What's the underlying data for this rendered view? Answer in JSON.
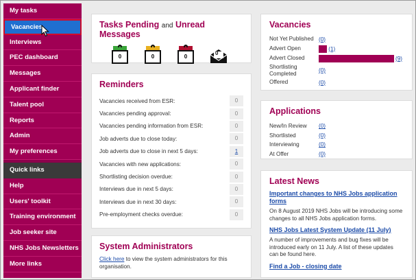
{
  "sidebar": {
    "items": [
      {
        "label": "My tasks"
      },
      {
        "label": "Vacancies"
      },
      {
        "label": "Interviews"
      },
      {
        "label": "PEC dashboard"
      },
      {
        "label": "Messages"
      },
      {
        "label": "Applicant finder"
      },
      {
        "label": "Talent pool"
      },
      {
        "label": "Reports"
      },
      {
        "label": "Admin"
      },
      {
        "label": "My preferences"
      }
    ],
    "quick_links_header": "Quick links",
    "quick_links": [
      {
        "label": "Help"
      },
      {
        "label": "Users' toolkit"
      },
      {
        "label": "Training environment"
      },
      {
        "label": "Job seeker site"
      },
      {
        "label": "NHS Jobs Newsletters"
      },
      {
        "label": "More links"
      }
    ],
    "active_color": "#1f6fd0",
    "brand_color": "#a00054"
  },
  "tasks": {
    "title_part1": "Tasks Pending",
    "title_and": "and",
    "title_part2": "Unread Messages",
    "icons": [
      {
        "name": "clipboard-green-icon",
        "count": "0",
        "color": "#3aa53a"
      },
      {
        "name": "clipboard-yellow-icon",
        "count": "0",
        "color": "#e8b020"
      },
      {
        "name": "clipboard-red-icon",
        "count": "0",
        "color": "#b01030"
      },
      {
        "name": "envelope-icon",
        "count": "0"
      }
    ]
  },
  "reminders": {
    "title": "Reminders",
    "rows": [
      {
        "label": "Vacancies received from ESR:",
        "value": "0"
      },
      {
        "label": "Vacancies pending approval:",
        "value": "0"
      },
      {
        "label": "Vacancies pending information from ESR:",
        "value": "0"
      },
      {
        "label": "Job adverts due to close today:",
        "value": "0"
      },
      {
        "label": "Job adverts due to close in next 5 days:",
        "value": "1"
      },
      {
        "label": "Vacancies with new applications:",
        "value": "0"
      },
      {
        "label": "Shortlisting decision overdue:",
        "value": "0"
      },
      {
        "label": "Interviews due in next 5 days:",
        "value": "0"
      },
      {
        "label": "Interviews due in next 30 days:",
        "value": "0"
      },
      {
        "label": "Pre-employment checks overdue:",
        "value": "0"
      }
    ]
  },
  "sysadmin": {
    "title": "System Administrators",
    "link": "Click here",
    "text": "to view the system administrators for this organisation."
  },
  "vacancies": {
    "title": "Vacancies",
    "rows": [
      {
        "label": "Not Yet Published",
        "count": "(0)",
        "value": 0
      },
      {
        "label": "Advert Open",
        "count": "(1)",
        "value": 1
      },
      {
        "label": "Advert Closed",
        "count": "(9)",
        "value": 9
      },
      {
        "label": "Shortlisting Completed",
        "count": "(0)",
        "value": 0
      },
      {
        "label": "Offered",
        "count": "(0)",
        "value": 0
      }
    ]
  },
  "applications": {
    "title": "Applications",
    "rows": [
      {
        "label": "New/In Review",
        "count": "(0)"
      },
      {
        "label": "Shortlisted",
        "count": "(0)"
      },
      {
        "label": "Interviewing",
        "count": "(0)"
      },
      {
        "label": "At Offer",
        "count": "(0)"
      }
    ]
  },
  "news": {
    "title": "Latest News",
    "items": [
      {
        "headline": "Important changes to NHS Jobs application forms",
        "text": "On 8 August 2019 NHS Jobs will be introducing some changes to all NHS Jobs application forms."
      },
      {
        "headline": "NHS Jobs Latest System Update (11 July)",
        "text": "A number of improvements and bug fixes will be introduced early on 11 July. A list of these updates can be found here."
      },
      {
        "headline": "Find a Job - closing date",
        "text": ""
      }
    ]
  }
}
